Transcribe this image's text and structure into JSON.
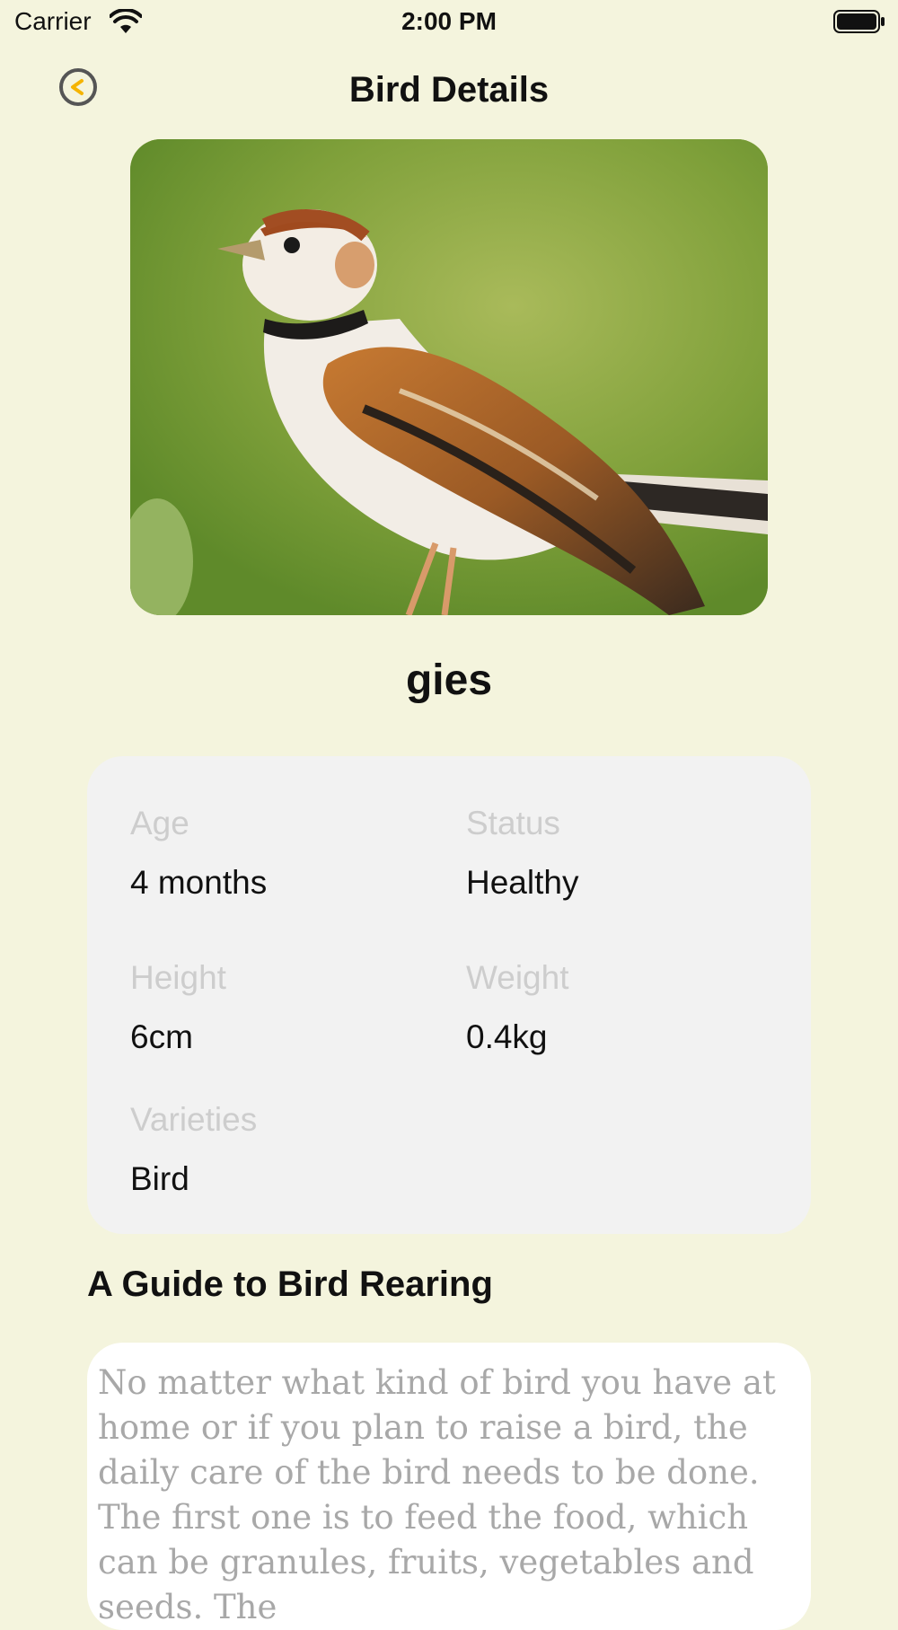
{
  "status_bar": {
    "carrier": "Carrier",
    "time": "2:00 PM"
  },
  "nav": {
    "title": "Bird Details",
    "back_icon": "back-arrow-circle-icon"
  },
  "bird": {
    "name": "gies",
    "photo_icon": "bird-photo"
  },
  "info": {
    "age_label": "Age",
    "age_value": "4 months",
    "status_label": "Status",
    "status_value": "Healthy",
    "height_label": "Height",
    "height_value": "6cm",
    "weight_label": "Weight",
    "weight_value": "0.4kg",
    "varieties_label": "Varieties",
    "varieties_value": "Bird"
  },
  "guide": {
    "title": "A Guide to Bird Rearing",
    "text": "No matter what kind of bird you have at home or if you plan to raise a bird, the daily care of the bird needs to be done. The first one is to feed the food, which can be granules, fruits, vegetables and seeds. The"
  },
  "colors": {
    "background": "#f4f4dd",
    "card": "#f2f2f2",
    "label": "#cdcdcd",
    "back_accent": "#f5b400"
  }
}
